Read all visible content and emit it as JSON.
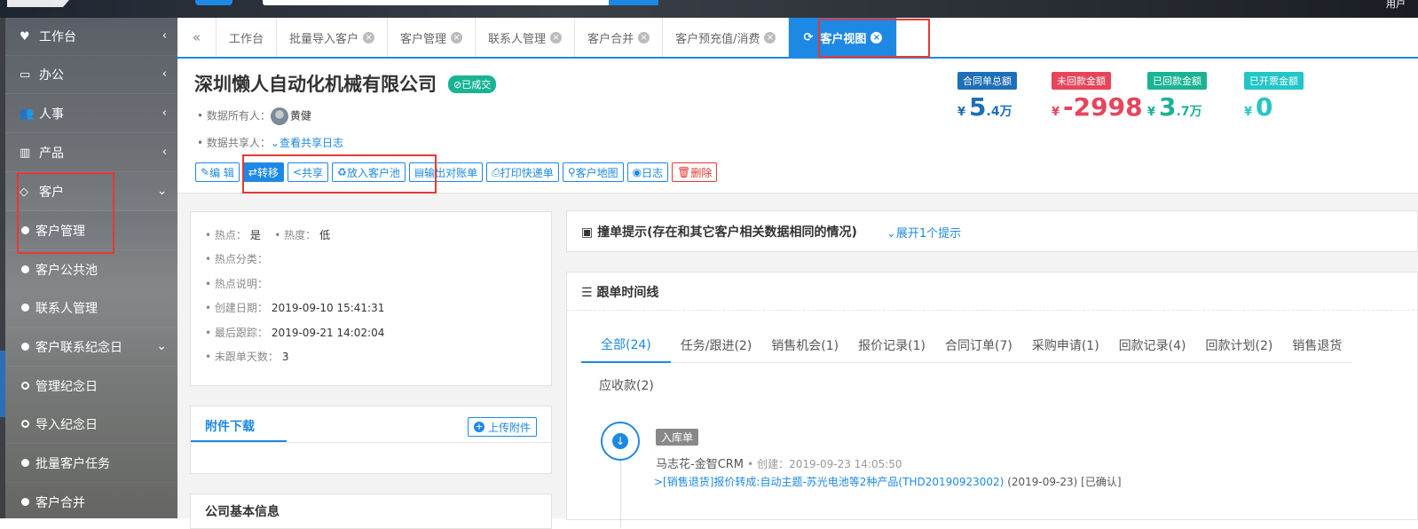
{
  "topbar": {
    "user": "用户"
  },
  "tabs": {
    "items": [
      {
        "label": "工作台",
        "closable": false
      },
      {
        "label": "批量导入客户",
        "closable": true
      },
      {
        "label": "客户管理",
        "closable": true
      },
      {
        "label": "联系人管理",
        "closable": true
      },
      {
        "label": "客户合并",
        "closable": true
      },
      {
        "label": "客户预充值/消费",
        "closable": true
      },
      {
        "label": "客户视图",
        "closable": true,
        "active": true
      }
    ]
  },
  "sidebar": {
    "items": [
      {
        "label": "工作台",
        "icon": "heart-icon"
      },
      {
        "label": "办公",
        "icon": "laptop-icon"
      },
      {
        "label": "人事",
        "icon": "users-icon"
      },
      {
        "label": "产品",
        "icon": "barcode-icon"
      },
      {
        "label": "客户",
        "icon": "diamond-icon",
        "expanded": true
      }
    ],
    "sub_items": [
      {
        "label": "客户管理",
        "marker": "dot"
      },
      {
        "label": "客户公共池",
        "marker": "dot"
      },
      {
        "label": "联系人管理",
        "marker": "dot"
      },
      {
        "label": "客户联系纪念日",
        "marker": "dot",
        "expandable": true
      },
      {
        "label": "管理纪念日",
        "marker": "ring"
      },
      {
        "label": "导入纪念日",
        "marker": "ring"
      },
      {
        "label": "批量客户任务",
        "marker": "dot"
      },
      {
        "label": "客户合并",
        "marker": "dot"
      }
    ]
  },
  "customer": {
    "name": "深圳懒人自动化机械有限公司",
    "status": "已成交",
    "owner_label": "数据所有人：",
    "owner": "黄健",
    "share_label": "数据共享人：",
    "share_link": "查看共享日志"
  },
  "actions": [
    {
      "label": "编 辑",
      "icon": "edit-icon",
      "style": "normal"
    },
    {
      "label": "转移",
      "icon": "transfer-icon",
      "style": "primary"
    },
    {
      "label": "共享",
      "icon": "share-icon",
      "style": "normal"
    },
    {
      "label": "放入客户池",
      "icon": "recycle-icon",
      "style": "normal"
    },
    {
      "label": "输出对账单",
      "icon": "statement-icon",
      "style": "normal"
    },
    {
      "label": "打印快递单",
      "icon": "print-icon",
      "style": "normal"
    },
    {
      "label": "客户地图",
      "icon": "map-pin-icon",
      "style": "normal"
    },
    {
      "label": "日志",
      "icon": "eye-icon",
      "style": "normal"
    },
    {
      "label": "删除",
      "icon": "trash-icon",
      "style": "danger"
    }
  ],
  "stats": [
    {
      "label": "合同单总额",
      "currency": "¥",
      "value": "5",
      "decimal": ".4万",
      "color": "#1e6fb8",
      "label_bg": "#1e6fb8"
    },
    {
      "label": "未回款金额",
      "currency": "¥",
      "value": "-2998",
      "decimal": "",
      "color": "#e8445a",
      "label_bg": "#e8445a"
    },
    {
      "label": "已回款金额",
      "currency": "¥",
      "value": "3",
      "decimal": ".7万",
      "color": "#1ab394",
      "label_bg": "#1ab394"
    },
    {
      "label": "已开票金额",
      "currency": "¥",
      "value": "0",
      "decimal": "",
      "color": "#23c6c8",
      "label_bg": "#23c6c8"
    }
  ],
  "info": {
    "hot_label": "热点：",
    "hot": "是",
    "heat_label": "热度：",
    "heat": "低",
    "hot_cat_label": "热点分类：",
    "hot_desc_label": "热点说明：",
    "created_label": "创建日期：",
    "created": "2019-09-10 15:41:31",
    "last_follow_label": "最后跟踪：",
    "last_follow": "2019-09-21 14:02:04",
    "no_follow_days_label": "未跟单天数：",
    "no_follow_days": "3"
  },
  "attachments": {
    "title": "附件下载",
    "upload": "上传附件"
  },
  "company_info": {
    "title": "公司基本信息"
  },
  "collision": {
    "title": "撞单提示(存在和其它客户相关数据相同的情况)",
    "expand": "展开1个提示"
  },
  "timeline": {
    "title": "跟单时间线",
    "tabs": [
      "全部(24)",
      "任务/跟进(2)",
      "销售机会(1)",
      "报价记录(1)",
      "合同订单(7)",
      "采购申请(1)",
      "回款记录(4)",
      "回款计划(2)",
      "销售退货"
    ],
    "tab_row2": "应收款(2)",
    "entry": {
      "badge": "入库单",
      "who": "马志花-金智CRM",
      "created_label": "创建：",
      "created": "2019-09-23 14:05:50",
      "link": ">[销售退货]报价转成:自动主题-苏光电池等2种产品(THD20190923002)",
      "date": "(2019-09-23)",
      "state": "[已确认]"
    }
  },
  "colors": {
    "accent": "#1e88e5",
    "success": "#1ab394",
    "danger": "#e53935",
    "highlight_box": "#e53935"
  }
}
